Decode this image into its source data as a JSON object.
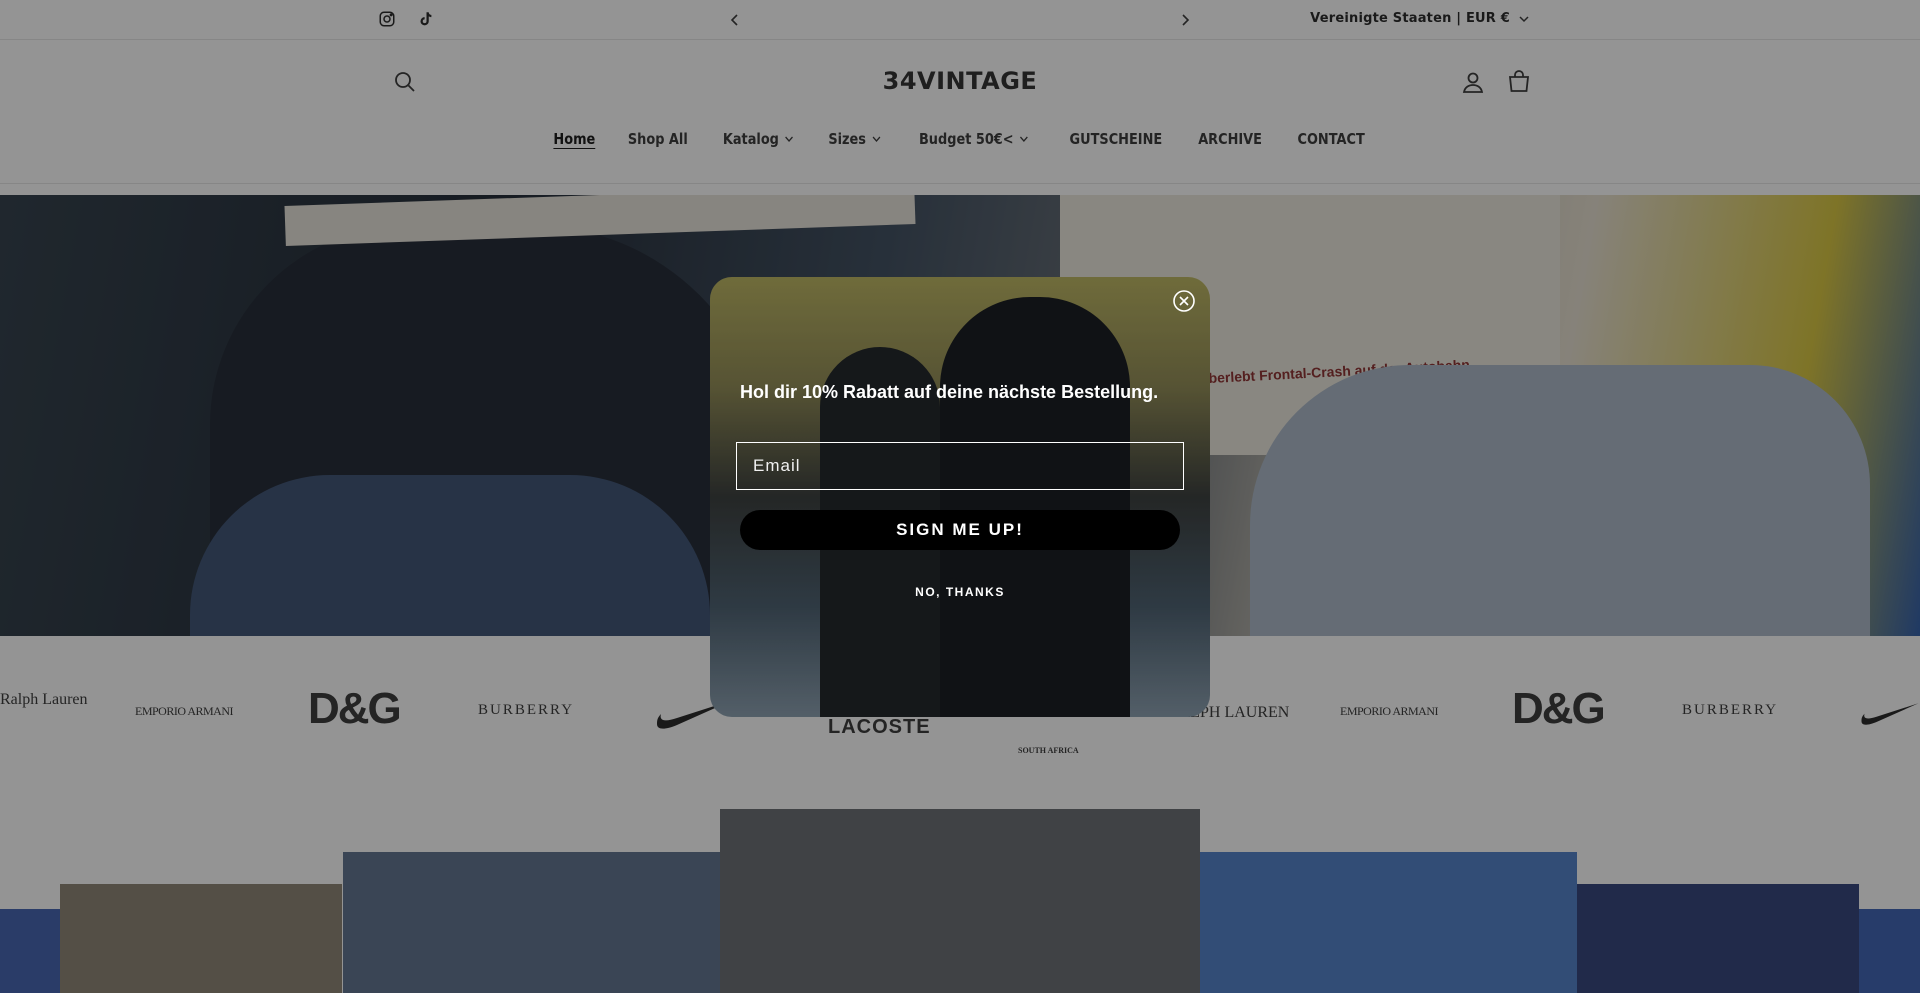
{
  "announcement": {
    "text": ""
  },
  "region": {
    "label": "Vereinigte Staaten | EUR €"
  },
  "header": {
    "logo": "34VINTAGE"
  },
  "nav": {
    "items": [
      {
        "label": "Home",
        "active": true,
        "dropdown": false
      },
      {
        "label": "Shop All",
        "active": false,
        "dropdown": false
      },
      {
        "label": "Katalog",
        "active": false,
        "dropdown": true
      },
      {
        "label": "Sizes",
        "active": false,
        "dropdown": true
      },
      {
        "label": "Budget 50€<",
        "active": false,
        "dropdown": true
      },
      {
        "label": "GUTSCHEINE",
        "active": false,
        "dropdown": false
      },
      {
        "label": "ARCHIVE",
        "active": false,
        "dropdown": false
      },
      {
        "label": "CONTACT",
        "active": false,
        "dropdown": false
      }
    ]
  },
  "hero": {
    "newspaper_headline": "Bussard überlebt Frontal-Crash auf der Autobahn"
  },
  "brands": {
    "items": [
      "Ralph Lauren",
      "EMPORIO ARMANI",
      "D&G",
      "BURBERRY",
      "LACOSTE",
      "SOUTH AFRICA",
      "RALPH LAUREN",
      "EMPORIO ARMANI",
      "D&G",
      "BURBERRY"
    ]
  },
  "popup": {
    "heading": "Hol dir 10% Rabatt auf deine nächste Bestellung.",
    "email_placeholder": "Email",
    "signup_label": "SIGN ME UP!",
    "decline_label": "NO, THANKS"
  },
  "icons": {
    "instagram": "instagram-icon",
    "tiktok": "tiktok-icon",
    "search": "search-icon",
    "account": "user-icon",
    "cart": "cart-icon",
    "close": "close-icon",
    "chevron": "chevron-down-icon"
  },
  "colors": {
    "overlay": "#121212",
    "button": "#000000",
    "text_dark": "#333333"
  }
}
